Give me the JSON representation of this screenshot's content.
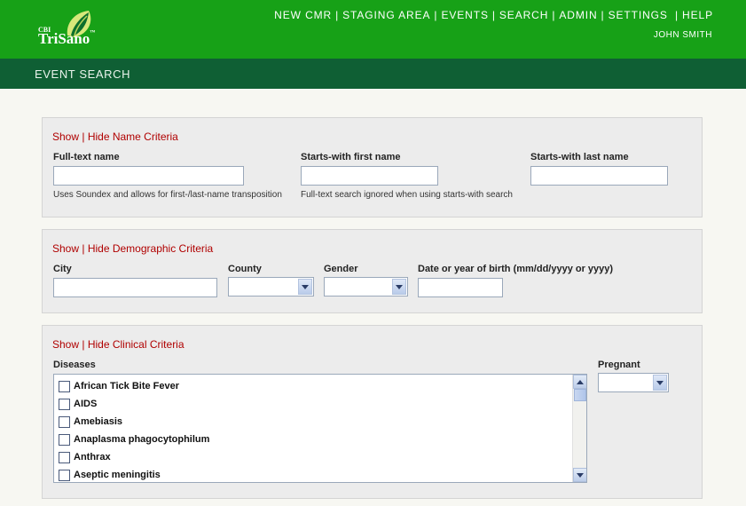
{
  "header": {
    "logo": {
      "prefix": "CBI",
      "name": "TriSano",
      "tm": "™"
    },
    "nav": [
      {
        "label": "NEW CMR"
      },
      {
        "label": "STAGING AREA"
      },
      {
        "label": "EVENTS"
      },
      {
        "label": "SEARCH"
      },
      {
        "label": "ADMIN"
      },
      {
        "label": "SETTINGS"
      },
      {
        "label": "HELP"
      }
    ],
    "user": "JOHN SMITH"
  },
  "page": {
    "title": "EVENT SEARCH"
  },
  "name_criteria": {
    "show": "Show",
    "sep": " | ",
    "hide_label": "Hide Name Criteria",
    "fulltext_label": "Full-text name",
    "fulltext_value": "",
    "fulltext_hint": "Uses Soundex and allows for first-/last-name transposition",
    "first_label": "Starts-with first name",
    "first_value": "",
    "first_hint": "Full-text search ignored when using starts-with search",
    "last_label": "Starts-with last name",
    "last_value": ""
  },
  "demographic_criteria": {
    "show": "Show",
    "sep": " | ",
    "hide_label": "Hide Demographic Criteria",
    "city_label": "City",
    "city_value": "",
    "county_label": "County",
    "county_value": "",
    "gender_label": "Gender",
    "gender_value": "",
    "dob_label": "Date or year of birth (mm/dd/yyyy or yyyy)",
    "dob_value": ""
  },
  "clinical_criteria": {
    "show": "Show",
    "sep": " | ",
    "hide_label": "Hide Clinical Criteria",
    "diseases_label": "Diseases",
    "diseases": [
      {
        "name": "African Tick Bite Fever",
        "checked": false
      },
      {
        "name": "AIDS",
        "checked": false
      },
      {
        "name": "Amebiasis",
        "checked": false
      },
      {
        "name": "Anaplasma phagocytophilum",
        "checked": false
      },
      {
        "name": "Anthrax",
        "checked": false
      },
      {
        "name": "Aseptic meningitis",
        "checked": false
      }
    ],
    "pregnant_label": "Pregnant",
    "pregnant_value": ""
  },
  "icons": {
    "logo": "leaf-logo-icon",
    "select_arrow": "chevron-down-icon",
    "scroll_up": "scroll-up-icon",
    "scroll_down": "scroll-down-icon"
  },
  "colors": {
    "header_green": "#17a117",
    "subbar_green": "#0f5f34",
    "link_red": "#b00000",
    "panel_bg": "#ececec",
    "page_bg": "#f7f7f2"
  }
}
